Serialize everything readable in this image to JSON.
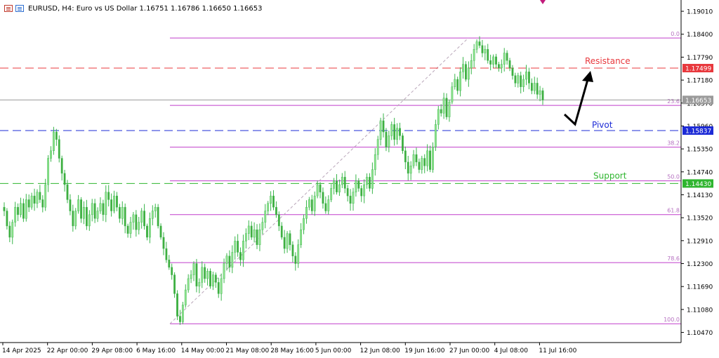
{
  "header": {
    "symbol_line": "EURUSD, H4:  Euro vs US Dollar  1.16751 1.16786 1.16650 1.16653"
  },
  "chart_data": {
    "type": "candlestick",
    "symbol": "EURUSD",
    "timeframe": "H4",
    "ylim": [
      1.102,
      1.1931
    ],
    "x_ticks": [
      "14 Apr 2025",
      "22 Apr 00:00",
      "29 Apr 08:00",
      "6 May 16:00",
      "14 May 00:00",
      "21 May 08:00",
      "28 May 16:00",
      "5 Jun 00:00",
      "12 Jun 08:00",
      "19 Jun 16:00",
      "27 Jun 00:00",
      "4 Jul 08:00",
      "11 Jul 16:00"
    ],
    "y_ticks": [
      "1.19010",
      "1.18400",
      "1.17790",
      "1.17180",
      "1.16570",
      "1.15960",
      "1.15350",
      "1.14740",
      "1.14130",
      "1.13520",
      "1.12910",
      "1.12300",
      "1.11690",
      "1.11080",
      "1.10470"
    ],
    "horizontal_lines": [
      {
        "name": "Resistance",
        "price": 1.17499,
        "label": "1.17499",
        "color": "#e8383d"
      },
      {
        "name": "Pivot",
        "price": 1.15837,
        "label": "1.15837",
        "color": "#1d2bd6"
      },
      {
        "name": "Support",
        "price": 1.1443,
        "label": "1.14430",
        "color": "#2fb52f"
      }
    ],
    "current_price": {
      "value": 1.16653,
      "label": "1.16653",
      "color": "#9a9a9a"
    },
    "fibonacci": {
      "high": 1.183,
      "low": 1.107,
      "levels": [
        {
          "ratio": 0.0,
          "label": "0.0"
        },
        {
          "ratio": 0.236,
          "label": "23.6"
        },
        {
          "ratio": 0.382,
          "label": "38.2"
        },
        {
          "ratio": 0.5,
          "label": "50.0"
        },
        {
          "ratio": 0.618,
          "label": "61.8"
        },
        {
          "ratio": 0.786,
          "label": "78.6"
        },
        {
          "ratio": 1.0,
          "label": "100.0"
        }
      ],
      "color": "#c13ecb"
    },
    "closes": [
      1.137,
      1.133,
      1.13,
      1.134,
      1.138,
      1.136,
      1.139,
      1.135,
      1.14,
      1.138,
      1.141,
      1.139,
      1.142,
      1.14,
      1.138,
      1.144,
      1.151,
      1.153,
      1.158,
      1.156,
      1.151,
      1.147,
      1.144,
      1.14,
      1.137,
      1.133,
      1.137,
      1.14,
      1.135,
      1.138,
      1.133,
      1.136,
      1.139,
      1.135,
      1.137,
      1.139,
      1.136,
      1.142,
      1.14,
      1.137,
      1.141,
      1.138,
      1.135,
      1.138,
      1.133,
      1.131,
      1.134,
      1.136,
      1.132,
      1.134,
      1.137,
      1.133,
      1.13,
      1.135,
      1.137,
      1.138,
      1.133,
      1.13,
      1.127,
      1.124,
      1.122,
      1.12,
      1.115,
      1.109,
      1.1075,
      1.112,
      1.116,
      1.119,
      1.12,
      1.123,
      1.117,
      1.118,
      1.122,
      1.119,
      1.121,
      1.117,
      1.12,
      1.118,
      1.115,
      1.119,
      1.123,
      1.125,
      1.122,
      1.126,
      1.129,
      1.126,
      1.124,
      1.129,
      1.131,
      1.133,
      1.13,
      1.132,
      1.128,
      1.132,
      1.134,
      1.137,
      1.139,
      1.141,
      1.138,
      1.136,
      1.133,
      1.13,
      1.127,
      1.131,
      1.128,
      1.125,
      1.123,
      1.128,
      1.132,
      1.135,
      1.138,
      1.14,
      1.137,
      1.141,
      1.144,
      1.142,
      1.139,
      1.137,
      1.14,
      1.143,
      1.145,
      1.142,
      1.144,
      1.146,
      1.143,
      1.141,
      1.139,
      1.142,
      1.145,
      1.143,
      1.141,
      1.144,
      1.146,
      1.143,
      1.148,
      1.152,
      1.156,
      1.161,
      1.158,
      1.154,
      1.157,
      1.16,
      1.156,
      1.159,
      1.157,
      1.153,
      1.15,
      1.147,
      1.149,
      1.152,
      1.15,
      1.148,
      1.151,
      1.149,
      1.153,
      1.148,
      1.154,
      1.16,
      1.164,
      1.163,
      1.167,
      1.162,
      1.166,
      1.17,
      1.172,
      1.169,
      1.174,
      1.176,
      1.172,
      1.175,
      1.177,
      1.18,
      1.182,
      1.181,
      1.179,
      1.18,
      1.177,
      1.176,
      1.178,
      1.176,
      1.175,
      1.176,
      1.179,
      1.177,
      1.175,
      1.173,
      1.171,
      1.173,
      1.17,
      1.172,
      1.174,
      1.171,
      1.169,
      1.171,
      1.168,
      1.169,
      1.1665
    ]
  }
}
